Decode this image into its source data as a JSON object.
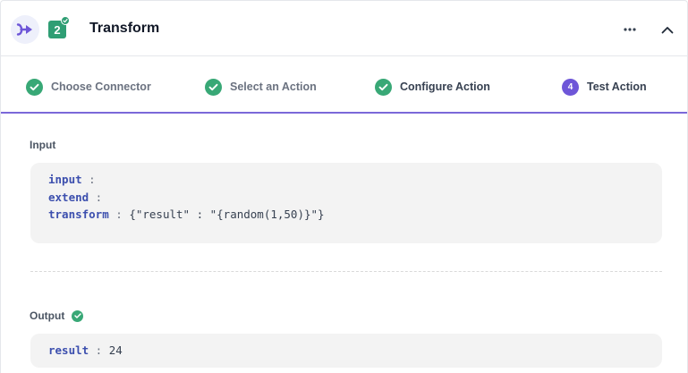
{
  "header": {
    "title": "Transform",
    "step_number": "2",
    "logo_icon": "transform-logo-icon",
    "menu_icon": "more-horizontal-icon",
    "collapse_icon": "chevron-up-icon"
  },
  "steps": [
    {
      "label": "Choose Connector",
      "status": "done",
      "marker": ""
    },
    {
      "label": "Select an Action",
      "status": "done",
      "marker": ""
    },
    {
      "label": "Configure Action",
      "status": "done",
      "marker": ""
    },
    {
      "label": "Test Action",
      "status": "current",
      "marker": "4"
    }
  ],
  "input": {
    "label": "Input",
    "rows": [
      {
        "key": "input",
        "sep": " : ",
        "value": ""
      },
      {
        "key": "extend",
        "sep": " : ",
        "value": ""
      },
      {
        "key": "transform",
        "sep": " : ",
        "value": "{\"result\" : \"{random(1,50)}\"}"
      }
    ]
  },
  "output": {
    "label": "Output",
    "status_icon": "check-circle-icon",
    "rows": [
      {
        "key": "result",
        "sep": " : ",
        "value": "24"
      }
    ]
  },
  "colors": {
    "accent": "#6e56d8",
    "success": "#38a876",
    "badge": "#2f9e74",
    "key": "#3c4fae"
  }
}
